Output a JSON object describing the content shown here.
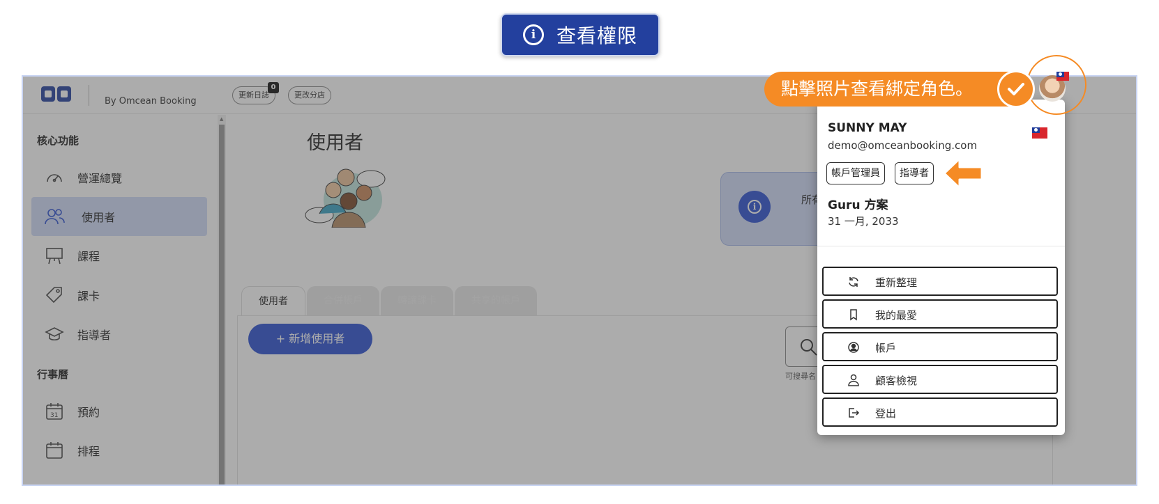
{
  "banner": {
    "label": "查看權限"
  },
  "header": {
    "by_text": "By Omcean Booking",
    "changelog_label": "更新日誌",
    "changelog_badge": "0",
    "switch_branch_label": "更改分店"
  },
  "sidebar": {
    "section_core": "核心功能",
    "section_calendar": "行事曆",
    "items": [
      {
        "label": "營運總覽",
        "icon": "speedometer-icon"
      },
      {
        "label": "使用者",
        "icon": "users-icon",
        "active": true
      },
      {
        "label": "課程",
        "icon": "easel-icon"
      },
      {
        "label": "課卡",
        "icon": "tag-icon"
      },
      {
        "label": "指導者",
        "icon": "graduation-cap-icon"
      },
      {
        "label": "預約",
        "icon": "calendar-31-icon"
      },
      {
        "label": "排程",
        "icon": "calendar-icon"
      }
    ]
  },
  "main": {
    "page_title": "使用者",
    "info_text": "所有",
    "tabs": [
      "使用者",
      "合併帳戶",
      "轉讓課卡",
      "共享的帳戶"
    ],
    "add_user_label": "+  新增使用者",
    "search_hint": "可搜尋名"
  },
  "user_menu": {
    "name": "SUNNY MAY",
    "email": "demo@omceanbooking.com",
    "roles": [
      "帳戶管理員",
      "指導者"
    ],
    "plan": "Guru 方案",
    "plan_date": "31 一月, 2033",
    "actions": [
      {
        "label": "重新整理",
        "icon": "refresh-icon"
      },
      {
        "label": "我的最愛",
        "icon": "bookmark-icon"
      },
      {
        "label": "帳戶",
        "icon": "account-circle-icon"
      },
      {
        "label": "顧客檢視",
        "icon": "person-icon"
      },
      {
        "label": "登出",
        "icon": "logout-icon"
      }
    ]
  },
  "callout": {
    "text": "點擊照片查看綁定角色。"
  },
  "colors": {
    "brand": "#23409e",
    "accent": "#f58b25",
    "primary": "#2d51d2"
  }
}
